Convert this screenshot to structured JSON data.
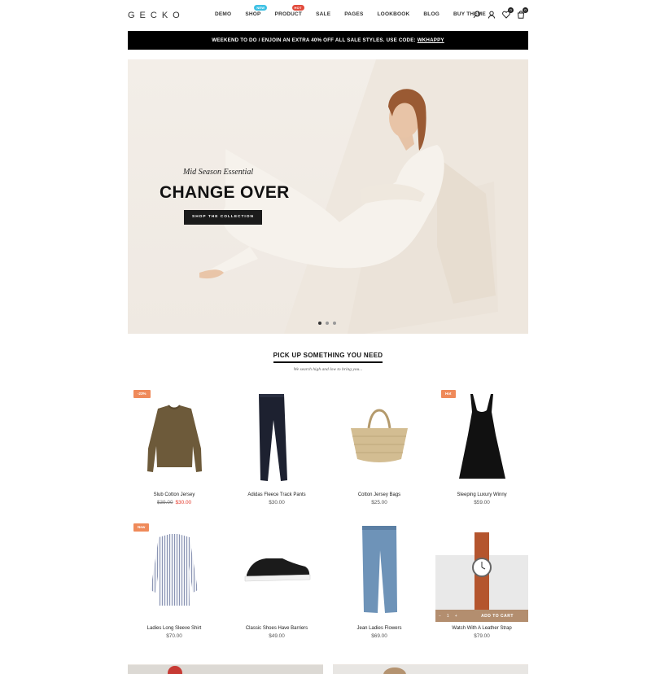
{
  "header": {
    "logo": "GECKO",
    "nav": [
      {
        "label": "DEMO",
        "badge": ""
      },
      {
        "label": "SHOP",
        "badge": "NEW"
      },
      {
        "label": "PRODUCT",
        "badge": "HOT"
      },
      {
        "label": "SALE",
        "badge": ""
      },
      {
        "label": "PAGES",
        "badge": ""
      },
      {
        "label": "LOOKBOOK",
        "badge": ""
      },
      {
        "label": "BLOG",
        "badge": ""
      },
      {
        "label": "BUY THEME",
        "badge": ""
      }
    ],
    "wishlist_count": "0",
    "cart_count": "0"
  },
  "promo": {
    "text": "WEEKEND TO DO / ENJOIN AN EXTRA 40% OFF ALL SALE STYLES. USE CODE: ",
    "code": "WKHAPPY"
  },
  "hero": {
    "subtitle": "Mid Season Essential",
    "title": "CHANGE OVER",
    "button": "SHOP THE COLLECTION",
    "slides": 3,
    "active_slide": 1
  },
  "section": {
    "title": "PICK UP SOMETHING YOU NEED",
    "subtitle": "We search high and low to bring you..."
  },
  "products": [
    {
      "name": "Slub Cotton Jersey",
      "old_price": "$39.00",
      "price": "$30.00",
      "tag": "-23%"
    },
    {
      "name": "Adidas Fleece Track Pants",
      "price": "$30.00",
      "tag": ""
    },
    {
      "name": "Cotton Jersey Bags",
      "price": "$25.00",
      "tag": ""
    },
    {
      "name": "Sleeping Luxury Winny",
      "price": "$59.00",
      "tag": "Hot"
    },
    {
      "name": "Ladies Long Sleeve Shirt",
      "price": "$70.00",
      "tag": "New"
    },
    {
      "name": "Classic Shoes Have Barriers",
      "price": "$49.00",
      "tag": ""
    },
    {
      "name": "Jean Ladies Flowers",
      "price": "$69.00",
      "tag": ""
    },
    {
      "name": "Watch With A Leather Strap",
      "price": "$79.00",
      "tag": ""
    }
  ],
  "cart_bar": {
    "minus": "−",
    "qty": "1",
    "plus": "+",
    "add": "ADD TO CART"
  },
  "colors": {
    "accent": "#ef8a5a",
    "sale_price": "#e53b2c",
    "cart_bar": "#b38e6f",
    "promo_bg": "#000000"
  }
}
